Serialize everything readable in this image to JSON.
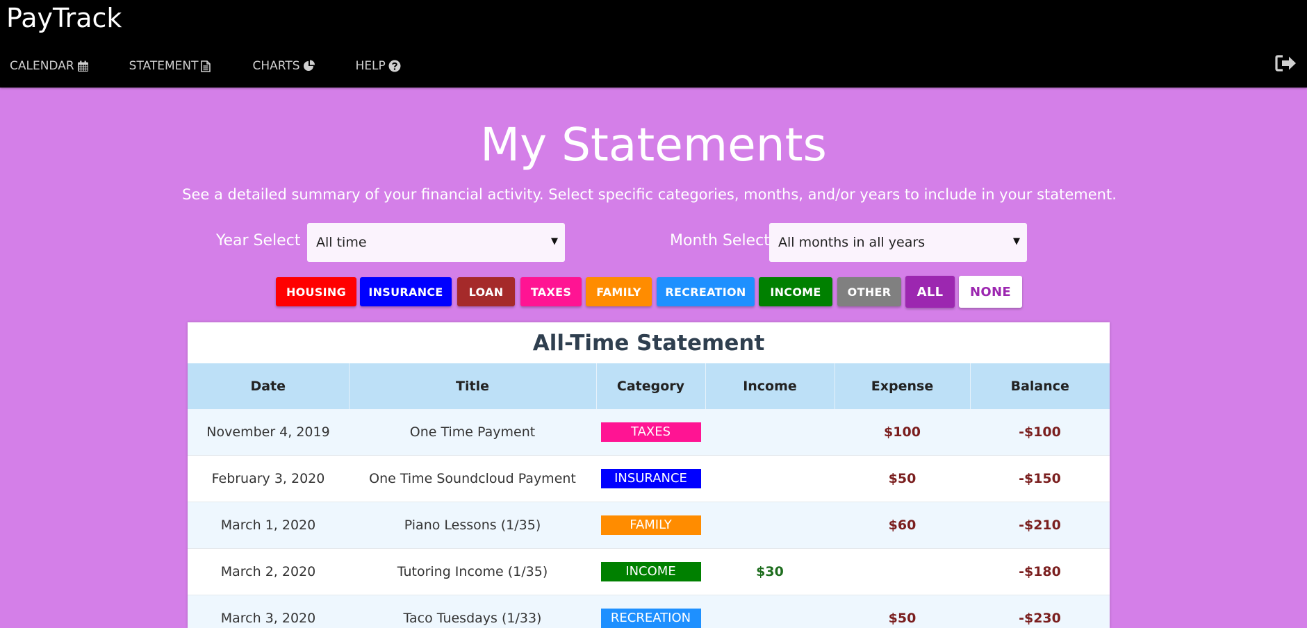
{
  "app": {
    "title": "PayTrack"
  },
  "nav": {
    "items": [
      {
        "label": "CALENDAR",
        "icon": "calendar-icon"
      },
      {
        "label": "STATEMENT",
        "icon": "document-icon"
      },
      {
        "label": "CHARTS",
        "icon": "pie-chart-icon"
      },
      {
        "label": "HELP",
        "icon": "question-circle-icon"
      }
    ],
    "logout_icon": "sign-out-icon"
  },
  "page": {
    "title": "My Statements",
    "subtitle": "See a detailed summary of your financial activity. Select specific categories, months, and/or years to include in your statement."
  },
  "filters": {
    "year_label": "Year Select",
    "year_value": "All time",
    "month_label": "Month Select",
    "month_value": "All months in all years"
  },
  "categories": [
    {
      "label": "HOUSING",
      "color": "#ff0000"
    },
    {
      "label": "INSURANCE",
      "color": "#0000ff"
    },
    {
      "label": "LOAN",
      "color": "#a52a2a"
    },
    {
      "label": "TAXES",
      "color": "#ff1493"
    },
    {
      "label": "FAMILY",
      "color": "#ff8c00"
    },
    {
      "label": "RECREATION",
      "color": "#1e90ff"
    },
    {
      "label": "INCOME",
      "color": "#008000"
    },
    {
      "label": "OTHER",
      "color": "#808080"
    },
    {
      "label": "ALL",
      "color": "#9c27b0"
    },
    {
      "label": "NONE",
      "color": "#ffffff"
    }
  ],
  "statement": {
    "title": "All-Time Statement",
    "columns": [
      "Date",
      "Title",
      "Category",
      "Income",
      "Expense",
      "Balance"
    ],
    "rows": [
      {
        "date": "November 4, 2019",
        "title": "One Time Payment",
        "category": "TAXES",
        "category_color": "#ff1493",
        "income": "",
        "expense": "$100",
        "balance": "-$100"
      },
      {
        "date": "February 3, 2020",
        "title": "One Time Soundcloud Payment",
        "category": "INSURANCE",
        "category_color": "#0000ff",
        "income": "",
        "expense": "$50",
        "balance": "-$150"
      },
      {
        "date": "March 1, 2020",
        "title": "Piano Lessons (1/35)",
        "category": "FAMILY",
        "category_color": "#ff8c00",
        "income": "",
        "expense": "$60",
        "balance": "-$210"
      },
      {
        "date": "March 2, 2020",
        "title": "Tutoring Income (1/35)",
        "category": "INCOME",
        "category_color": "#008000",
        "income": "$30",
        "expense": "",
        "balance": "-$180"
      },
      {
        "date": "March 3, 2020",
        "title": "Taco Tuesdays (1/33)",
        "category": "RECREATION",
        "category_color": "#1e90ff",
        "income": "",
        "expense": "$50",
        "balance": "-$230"
      }
    ]
  }
}
